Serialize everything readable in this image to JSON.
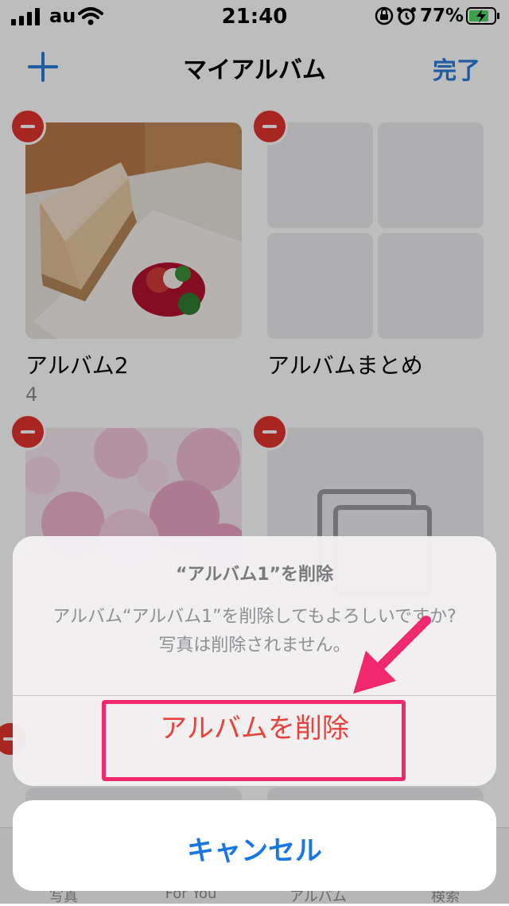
{
  "status_bar": {
    "carrier": "au",
    "time": "21:40",
    "battery_percent": "77%",
    "icons": [
      "signal-icon",
      "wifi-icon",
      "orientation-lock-icon",
      "alarm-icon",
      "battery-charging-icon"
    ]
  },
  "nav": {
    "title": "マイアルバム",
    "done_label": "完了",
    "add_icon": "plus-icon"
  },
  "albums": [
    {
      "name": "アルバム2",
      "count": "4"
    },
    {
      "name": "アルバムまとめ",
      "count": ""
    }
  ],
  "tabs": [
    {
      "label": "写真"
    },
    {
      "label": "For You"
    },
    {
      "label": "アルバム"
    },
    {
      "label": "検索"
    }
  ],
  "action_sheet": {
    "title": "“アルバム1”を削除",
    "message": "アルバム“アルバム1”を削除してもよろしいですか? 写真は削除されません。",
    "destructive_label": "アルバムを削除",
    "cancel_label": "キャンセル"
  },
  "colors": {
    "accent_blue": "#1877e0",
    "destructive_red": "#e8413a",
    "highlight_pink": "#f0286e",
    "delete_badge_red": "#e3342f"
  }
}
